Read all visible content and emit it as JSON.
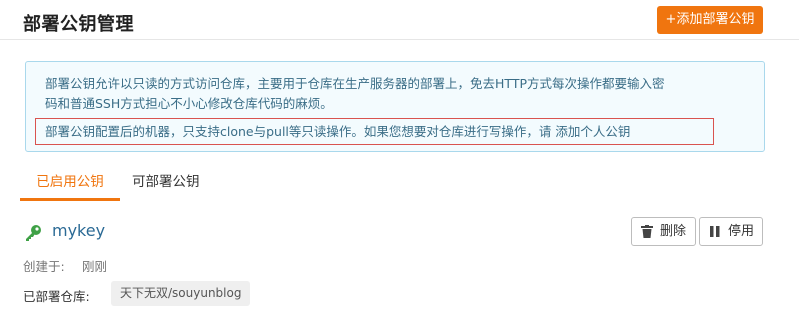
{
  "header": {
    "title": "部署公钥管理",
    "add_button_label": "+添加部署公钥"
  },
  "info": {
    "line1": "部署公钥允许以只读的方式访问仓库，主要用于仓库在生产服务器的部署上，免去HTTP方式每次操作都要输入密",
    "line2": "码和普通SSH方式担心不小心修改仓库代码的麻烦。",
    "line3": "部署公钥配置后的机器，只支持clone与pull等只读操作。如果您想要对仓库进行写操作，请 添加个人公钥"
  },
  "tabs": [
    {
      "label": "已启用公钥",
      "active": true
    },
    {
      "label": "可部署公钥",
      "active": false
    }
  ],
  "key": {
    "name": "mykey",
    "icon": "key-icon",
    "delete_label": "删除",
    "disable_label": "停用",
    "created_label": "创建于:",
    "created_value": "刚刚",
    "repos_label": "已部署仓库:",
    "repos": [
      "天下无双/souyunblog"
    ]
  },
  "colors": {
    "accent": "#f0750f",
    "info_bg": "#f3fbfe",
    "info_border": "#a9d8ec",
    "info_text": "#3a6d87",
    "highlight_border": "#d9534f",
    "key_icon": "#3fa146",
    "key_name": "#2b6a95"
  }
}
